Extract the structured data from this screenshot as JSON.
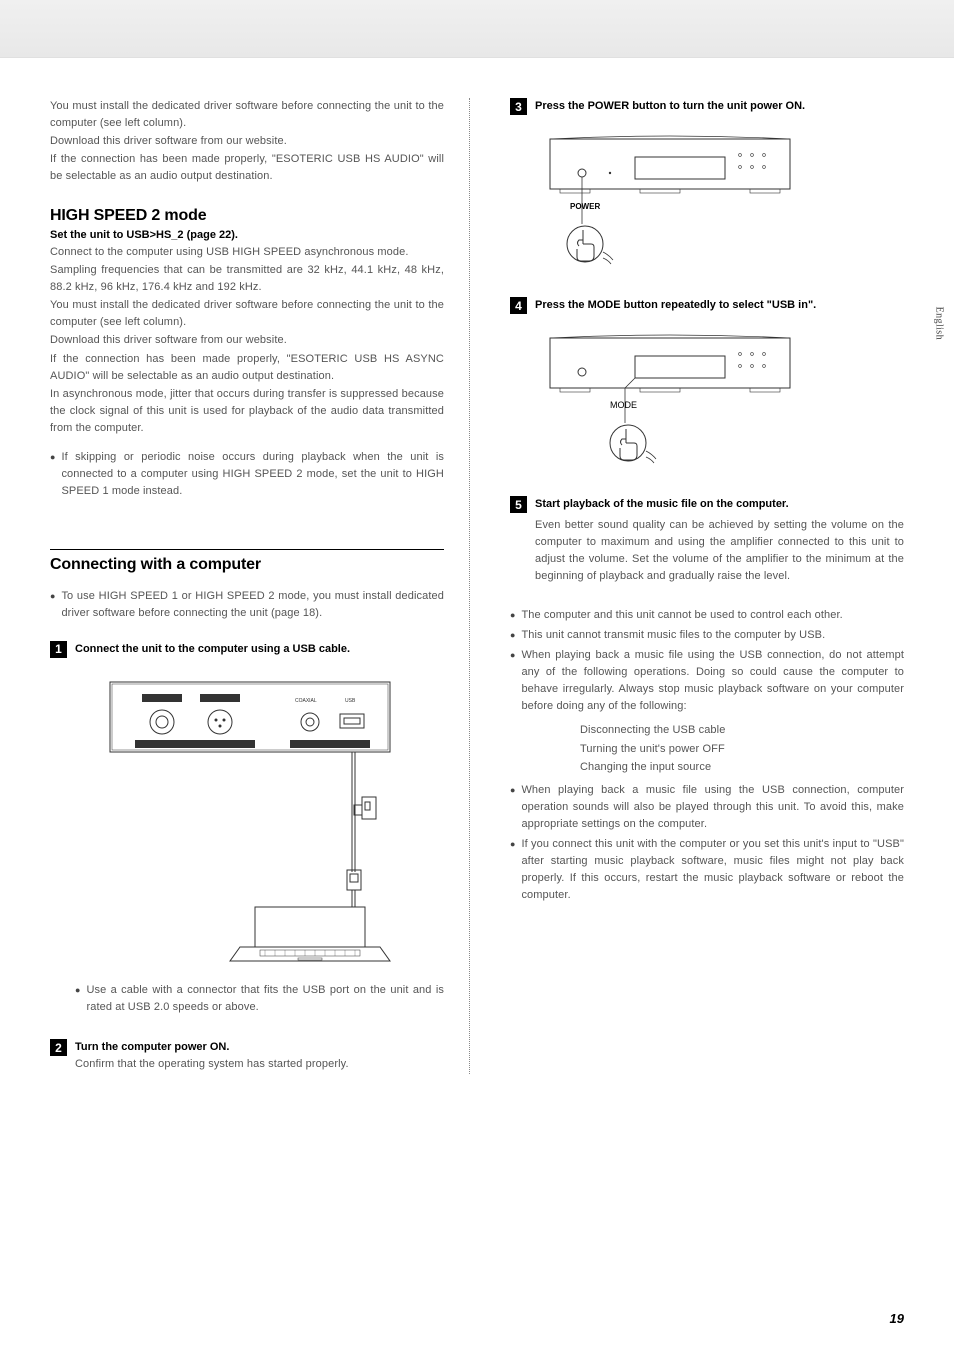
{
  "lang_tab": "English",
  "page_number": "19",
  "left": {
    "intro_p1": "You must install the dedicated driver software before connecting the unit to the computer (see left column).",
    "intro_p2": "Download this driver software from our website.",
    "intro_p3": "If the connection has been made properly, \"ESOTERIC USB HS AUDIO\" will be selectable as an audio output destination.",
    "hs2_heading": "HIGH SPEED 2 mode",
    "hs2_set": "Set the unit to USB>HS_2 (page 22).",
    "hs2_p1": "Connect to the computer using USB HIGH SPEED asynchronous mode.",
    "hs2_p2": "Sampling frequencies that can be transmitted are 32 kHz, 44.1 kHz, 48 kHz, 88.2 kHz, 96 kHz, 176.4 kHz and 192 kHz.",
    "hs2_p3": "You must install the dedicated driver software before connecting the unit to the computer (see left column).",
    "hs2_p4": "Download this driver software from our website.",
    "hs2_p5": "If the connection has been made properly, \"ESOTERIC USB HS ASYNC AUDIO\" will be selectable as an audio output destination.",
    "hs2_p6": "In asynchronous mode, jitter that occurs during transfer is suppressed because the clock signal of this unit is used for playback of the audio data transmitted from the computer.",
    "hs2_bullet": "If skipping or periodic noise occurs during playback when the unit is connected to a computer using HIGH SPEED 2 mode, set the unit to HIGH SPEED 1 mode instead.",
    "connect_heading": "Connecting with a computer",
    "connect_bullet": "To use HIGH SPEED 1 or HIGH SPEED 2 mode, you must install dedicated driver software before connecting the unit (page 18).",
    "step1_title": "Connect the unit to the computer using a USB cable.",
    "step1_bullet": "Use a cable with a connector that fits the USB port on the unit and is rated at USB 2.0 speeds or above.",
    "step2_title": "Turn the computer power ON.",
    "step2_body": "Confirm that the operating system has started properly."
  },
  "right": {
    "step3_title": "Press the POWER button to turn the unit power ON.",
    "diag3_label": "POWER",
    "step4_title": "Press the MODE button repeatedly to select \"USB in\".",
    "diag4_label": "MODE",
    "step5_title": "Start playback of the music file on the computer.",
    "step5_body": "Even better sound quality can be achieved by setting the volume on the computer to maximum and using the amplifier connected to this unit to adjust the volume. Set the volume of the amplifier to the minimum at the beginning of playback and gradually raise the level.",
    "b1": "The computer and this unit cannot be used to control each other.",
    "b2": "This unit cannot transmit music files to the computer by USB.",
    "b3": "When playing back a music file using the USB connection, do not attempt any of the following operations. Doing so could cause the computer to behave irregularly. Always stop music playback software on your computer before doing any of the following:",
    "b3_i1": "Disconnecting the USB cable",
    "b3_i2": "Turning the unit's power OFF",
    "b3_i3": "Changing the input source",
    "b4": "When playing back a music file using the USB connection, computer operation sounds will also be played through this unit. To avoid this, make appropriate settings on the computer.",
    "b5": "If you connect this unit with the computer or you set this unit's input to \"USB\" after starting music playback software, music files might not play back properly. If this occurs, restart the music playback software or reboot the computer."
  },
  "step_numbers": {
    "s1": "1",
    "s2": "2",
    "s3": "3",
    "s4": "4",
    "s5": "5"
  }
}
